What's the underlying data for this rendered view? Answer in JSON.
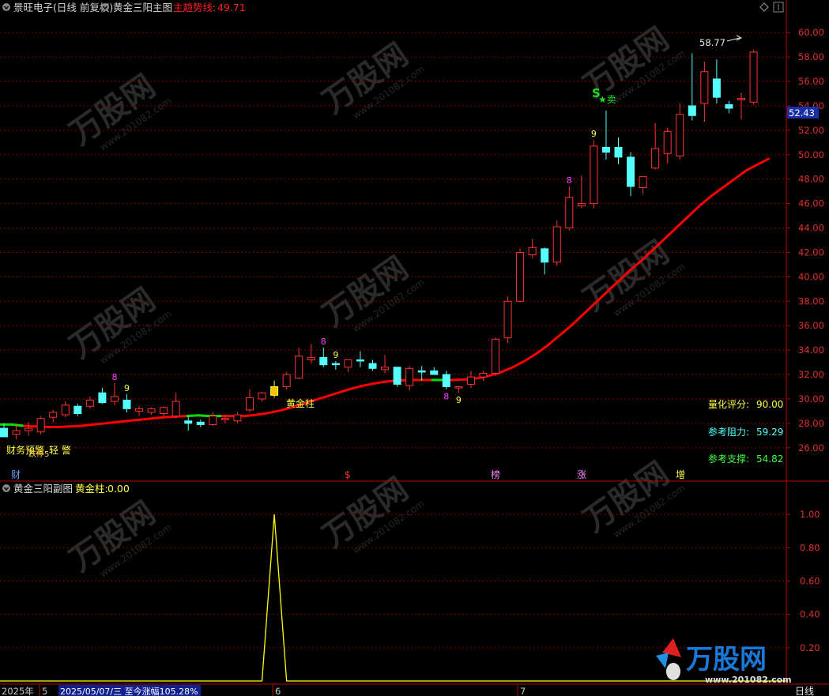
{
  "header": {
    "stock": "景旺电子(日线 前复权)",
    "indicator": "黄金三阳主图",
    "trend_label": "主趋势线:",
    "trend_value": "49.71"
  },
  "sub_header": {
    "indicator": "黄金三阳副图",
    "series_label": "黄金柱:",
    "series_value": "0.00"
  },
  "stats": {
    "score_label": "量化评分:",
    "score_value": "90.00",
    "resistance_label": "参考阻力:",
    "resistance_value": "59.29",
    "support_label": "参考支撑:",
    "support_value": "54.82"
  },
  "annotations": {
    "high_label": "58.77",
    "sell_s": "S",
    "sell_text": "★卖",
    "golden_bar": "黄金柱",
    "warn_left": "财务预警",
    "warn_left2": "轻 警",
    "warn_left3": "跌停5"
  },
  "price_tag": "52.43",
  "event_markers": [
    "财",
    "$",
    "榜",
    "涨",
    "增"
  ],
  "bottom_bar": {
    "year": "2025年",
    "m5": "5",
    "info": "2025/05/07/三  至今涨幅105.28%",
    "m6": "6",
    "m7": "7",
    "period": "日线"
  },
  "watermark": {
    "brand": "万股网",
    "url": "www.201082.com"
  },
  "colors": {
    "up": "#ff3232",
    "down": "#54ffff",
    "trend": "#ff0000",
    "trend_green": "#00e000",
    "grid": "#8a0000",
    "golden": "#ffff00"
  },
  "chart_data": {
    "type": "candlestick",
    "main_ylim": [
      24.5,
      61.5
    ],
    "main_yticks": [
      26,
      28,
      30,
      32,
      34,
      36,
      38,
      40,
      42,
      44,
      46,
      48,
      50,
      52,
      54,
      56,
      58,
      60
    ],
    "sub_ylim": [
      0,
      1.1
    ],
    "sub_yticks": [
      "1.00",
      "0.80",
      "0.60",
      "0.40",
      "0.20"
    ],
    "candles": [
      {
        "o": 27.6,
        "h": 28.0,
        "l": 27.1,
        "c": 26.9
      },
      {
        "o": 27.1,
        "h": 27.9,
        "l": 26.7,
        "c": 27.4
      },
      {
        "o": 27.4,
        "h": 28.1,
        "l": 27.0,
        "c": 27.6
      },
      {
        "o": 27.3,
        "h": 28.6,
        "l": 27.1,
        "c": 28.4
      },
      {
        "o": 28.5,
        "h": 29.1,
        "l": 28.1,
        "c": 28.9
      },
      {
        "o": 28.7,
        "h": 29.8,
        "l": 28.5,
        "c": 29.5
      },
      {
        "o": 29.4,
        "h": 29.6,
        "l": 28.6,
        "c": 28.8
      },
      {
        "o": 29.4,
        "h": 30.2,
        "l": 29.2,
        "c": 29.9
      },
      {
        "o": 30.5,
        "h": 30.9,
        "l": 29.6,
        "c": 29.7
      },
      {
        "o": 29.8,
        "h": 31.3,
        "l": 29.5,
        "c": 30.2
      },
      {
        "o": 29.9,
        "h": 30.4,
        "l": 28.9,
        "c": 29.2
      },
      {
        "o": 29.0,
        "h": 29.4,
        "l": 28.6,
        "c": 29.2
      },
      {
        "o": 28.9,
        "h": 29.3,
        "l": 28.7,
        "c": 29.2
      },
      {
        "o": 28.8,
        "h": 29.4,
        "l": 28.6,
        "c": 29.3
      },
      {
        "o": 28.6,
        "h": 30.5,
        "l": 28.4,
        "c": 29.8
      },
      {
        "o": 28.2,
        "h": 28.6,
        "l": 27.4,
        "c": 28.0
      },
      {
        "o": 28.1,
        "h": 28.3,
        "l": 27.7,
        "c": 27.9
      },
      {
        "o": 27.9,
        "h": 28.9,
        "l": 27.8,
        "c": 28.6
      },
      {
        "o": 28.3,
        "h": 28.7,
        "l": 28.0,
        "c": 28.4
      },
      {
        "o": 28.2,
        "h": 28.9,
        "l": 28.0,
        "c": 28.7
      },
      {
        "o": 29.1,
        "h": 30.8,
        "l": 28.9,
        "c": 30.1
      },
      {
        "o": 30.0,
        "h": 30.6,
        "l": 29.8,
        "c": 30.5
      },
      {
        "o": 30.3,
        "h": 31.5,
        "l": 30.1,
        "c": 31.0
      },
      {
        "o": 31.0,
        "h": 32.2,
        "l": 30.8,
        "c": 32.0
      },
      {
        "o": 31.7,
        "h": 34.2,
        "l": 31.6,
        "c": 33.5
      },
      {
        "o": 33.2,
        "h": 34.5,
        "l": 32.9,
        "c": 33.4
      },
      {
        "o": 33.4,
        "h": 34.2,
        "l": 32.6,
        "c": 32.8
      },
      {
        "o": 32.9,
        "h": 33.1,
        "l": 32.4,
        "c": 32.8
      },
      {
        "o": 32.6,
        "h": 33.2,
        "l": 32.2,
        "c": 33.2
      },
      {
        "o": 33.2,
        "h": 33.9,
        "l": 32.6,
        "c": 33.1
      },
      {
        "o": 32.9,
        "h": 33.2,
        "l": 32.3,
        "c": 32.5
      },
      {
        "o": 32.4,
        "h": 33.6,
        "l": 32.1,
        "c": 32.6
      },
      {
        "o": 32.6,
        "h": 32.6,
        "l": 31.0,
        "c": 31.2
      },
      {
        "o": 31.1,
        "h": 32.7,
        "l": 30.7,
        "c": 32.5
      },
      {
        "o": 32.3,
        "h": 32.7,
        "l": 31.5,
        "c": 32.2
      },
      {
        "o": 32.3,
        "h": 32.6,
        "l": 32.1,
        "c": 32.0
      },
      {
        "o": 32.0,
        "h": 32.3,
        "l": 30.8,
        "c": 31.0
      },
      {
        "o": 30.9,
        "h": 31.1,
        "l": 30.5,
        "c": 31.0
      },
      {
        "o": 31.2,
        "h": 32.3,
        "l": 30.9,
        "c": 31.8
      },
      {
        "o": 31.8,
        "h": 32.3,
        "l": 31.5,
        "c": 32.1
      },
      {
        "o": 32.1,
        "h": 35.0,
        "l": 31.9,
        "c": 34.9
      },
      {
        "o": 35.0,
        "h": 38.4,
        "l": 34.6,
        "c": 38.0
      },
      {
        "o": 38.0,
        "h": 42.3,
        "l": 37.9,
        "c": 42.0
      },
      {
        "o": 41.8,
        "h": 43.1,
        "l": 41.5,
        "c": 42.4
      },
      {
        "o": 42.3,
        "h": 42.4,
        "l": 40.2,
        "c": 41.2
      },
      {
        "o": 41.2,
        "h": 44.6,
        "l": 40.9,
        "c": 44.1
      },
      {
        "o": 44.0,
        "h": 47.4,
        "l": 43.8,
        "c": 46.5
      },
      {
        "o": 45.8,
        "h": 48.3,
        "l": 45.6,
        "c": 46.0
      },
      {
        "o": 46.0,
        "h": 51.2,
        "l": 45.6,
        "c": 50.7
      },
      {
        "o": 50.6,
        "h": 53.6,
        "l": 49.6,
        "c": 50.2
      },
      {
        "o": 50.6,
        "h": 51.4,
        "l": 49.2,
        "c": 49.8
      },
      {
        "o": 49.8,
        "h": 50.2,
        "l": 46.6,
        "c": 47.4
      },
      {
        "o": 47.3,
        "h": 48.1,
        "l": 46.8,
        "c": 48.2
      },
      {
        "o": 48.9,
        "h": 52.6,
        "l": 48.8,
        "c": 50.5
      },
      {
        "o": 50.1,
        "h": 52.2,
        "l": 49.3,
        "c": 51.9
      },
      {
        "o": 49.9,
        "h": 54.2,
        "l": 49.6,
        "c": 53.3
      },
      {
        "o": 54.0,
        "h": 58.3,
        "l": 52.8,
        "c": 53.2
      },
      {
        "o": 54.2,
        "h": 57.6,
        "l": 52.7,
        "c": 56.8
      },
      {
        "o": 56.2,
        "h": 57.8,
        "l": 54.2,
        "c": 54.7
      },
      {
        "o": 54.1,
        "h": 54.4,
        "l": 53.4,
        "c": 53.8
      },
      {
        "o": 54.5,
        "h": 55.1,
        "l": 52.9,
        "c": 54.6
      },
      {
        "o": 54.3,
        "h": 58.6,
        "l": 54.1,
        "c": 58.4
      }
    ],
    "trend_line": [
      27.9,
      27.9,
      27.8,
      27.75,
      27.7,
      27.7,
      27.75,
      27.8,
      27.9,
      28.0,
      28.1,
      28.2,
      28.3,
      28.4,
      28.5,
      28.55,
      28.6,
      28.65,
      28.6,
      28.6,
      28.6,
      28.6,
      28.7,
      28.85,
      29.05,
      29.3,
      29.6,
      29.9,
      30.2,
      30.5,
      30.8,
      31.05,
      31.25,
      31.4,
      31.5,
      31.55,
      31.55,
      31.55,
      31.55,
      31.55,
      31.6,
      31.7,
      31.9,
      32.2,
      32.6,
      33.1,
      33.7,
      34.4,
      35.2,
      36.0,
      36.9,
      37.8,
      38.7,
      39.6,
      40.5,
      41.3,
      42.2,
      43.1,
      44.0,
      44.9,
      45.8,
      46.6,
      47.3,
      48.0,
      48.7,
      49.2,
      49.7
    ],
    "trend_green_segments": [
      [
        0,
        2
      ],
      [
        16,
        19
      ],
      [
        37,
        38
      ]
    ],
    "golden_bar_index": 22,
    "td_counts": [
      {
        "i": 9,
        "n": "8",
        "pos": "above",
        "color": "#ff40ff"
      },
      {
        "i": 10,
        "n": "9",
        "pos": "above",
        "color": "#ffff40"
      },
      {
        "i": 26,
        "n": "8",
        "pos": "above",
        "color": "#ff40ff"
      },
      {
        "i": 27,
        "n": "9",
        "pos": "above",
        "color": "#ffff40"
      },
      {
        "i": 36,
        "n": "8",
        "pos": "below",
        "color": "#ff40ff"
      },
      {
        "i": 37,
        "n": "9",
        "pos": "below",
        "color": "#ffff40"
      },
      {
        "i": 46,
        "n": "8",
        "pos": "above",
        "color": "#ff40ff"
      },
      {
        "i": 48,
        "n": "9",
        "pos": "above",
        "color": "#ffff40"
      }
    ],
    "sub_series": {
      "name": "黄金柱",
      "spike_index": 22,
      "values": "0 except 1.00 at spike"
    }
  }
}
